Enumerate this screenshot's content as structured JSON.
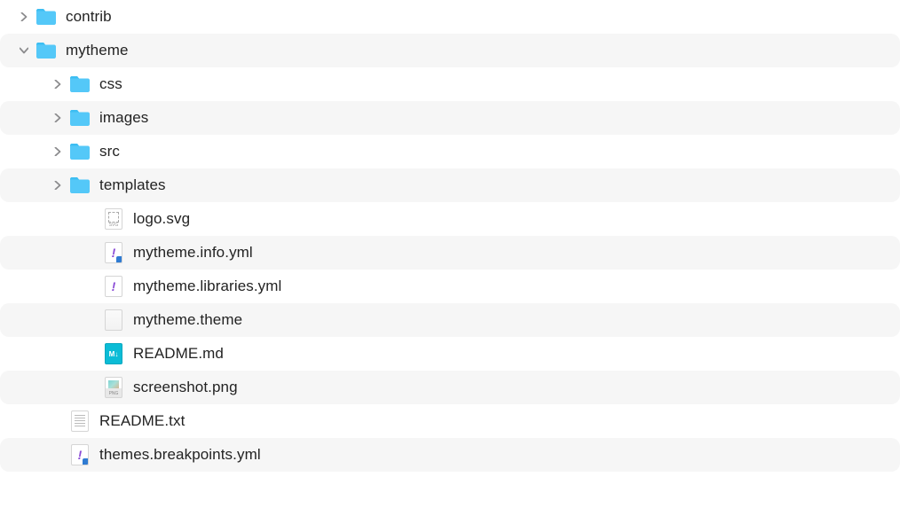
{
  "tree": {
    "rows": [
      {
        "indent": 0,
        "expandable": true,
        "expanded": false,
        "icon": "folder",
        "label": "contrib",
        "striped": false
      },
      {
        "indent": 0,
        "expandable": true,
        "expanded": true,
        "icon": "folder",
        "label": "mytheme",
        "striped": true
      },
      {
        "indent": 1,
        "expandable": true,
        "expanded": false,
        "icon": "folder",
        "label": "css",
        "striped": false
      },
      {
        "indent": 1,
        "expandable": true,
        "expanded": false,
        "icon": "folder",
        "label": "images",
        "striped": true
      },
      {
        "indent": 1,
        "expandable": true,
        "expanded": false,
        "icon": "folder",
        "label": "src",
        "striped": false
      },
      {
        "indent": 1,
        "expandable": true,
        "expanded": false,
        "icon": "folder",
        "label": "templates",
        "striped": true
      },
      {
        "indent": 2,
        "expandable": false,
        "expanded": false,
        "icon": "svg-file",
        "label": "logo.svg",
        "striped": false
      },
      {
        "indent": 2,
        "expandable": false,
        "expanded": false,
        "icon": "yml-file-vscode",
        "label": "mytheme.info.yml",
        "striped": true
      },
      {
        "indent": 2,
        "expandable": false,
        "expanded": false,
        "icon": "yml-file",
        "label": "mytheme.libraries.yml",
        "striped": false
      },
      {
        "indent": 2,
        "expandable": false,
        "expanded": false,
        "icon": "blank-file",
        "label": "mytheme.theme",
        "striped": true
      },
      {
        "indent": 2,
        "expandable": false,
        "expanded": false,
        "icon": "md-file",
        "label": "README.md",
        "striped": false
      },
      {
        "indent": 2,
        "expandable": false,
        "expanded": false,
        "icon": "png-file",
        "label": "screenshot.png",
        "striped": true
      },
      {
        "indent": 1,
        "expandable": false,
        "expanded": false,
        "icon": "txt-file",
        "label": "README.txt",
        "striped": false
      },
      {
        "indent": 1,
        "expandable": false,
        "expanded": false,
        "icon": "yml-file-vscode",
        "label": "themes.breakpoints.yml",
        "striped": true
      }
    ]
  },
  "colors": {
    "folder_fill": "#54c8f8",
    "folder_tab": "#3dbef2",
    "chevron": "#8b8b8d"
  }
}
